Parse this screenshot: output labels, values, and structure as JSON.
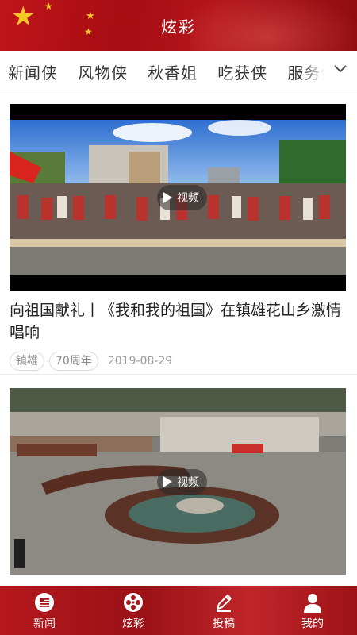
{
  "header": {
    "title": "炫彩"
  },
  "tabs": [
    {
      "label": "新闻侠"
    },
    {
      "label": "风物侠"
    },
    {
      "label": "秋香姐"
    },
    {
      "label": "吃获侠"
    },
    {
      "label": "服务侠"
    }
  ],
  "video_badge_label": "视频",
  "articles": [
    {
      "title": "向祖国献礼丨《我和我的祖国》在镇雄花山乡激情唱响",
      "tags": [
        "镇雄",
        "70周年"
      ],
      "date": "2019-08-29"
    },
    {
      "title": "",
      "tags": [],
      "date": ""
    }
  ],
  "bottom_nav": [
    {
      "label": "新闻",
      "icon": "news-icon"
    },
    {
      "label": "炫彩",
      "icon": "film-reel-icon"
    },
    {
      "label": "投稿",
      "icon": "pencil-icon"
    },
    {
      "label": "我的",
      "icon": "user-icon"
    }
  ],
  "colors": {
    "brand_red": "#b5181d",
    "text_dark": "#222222",
    "text_muted": "#999999"
  }
}
